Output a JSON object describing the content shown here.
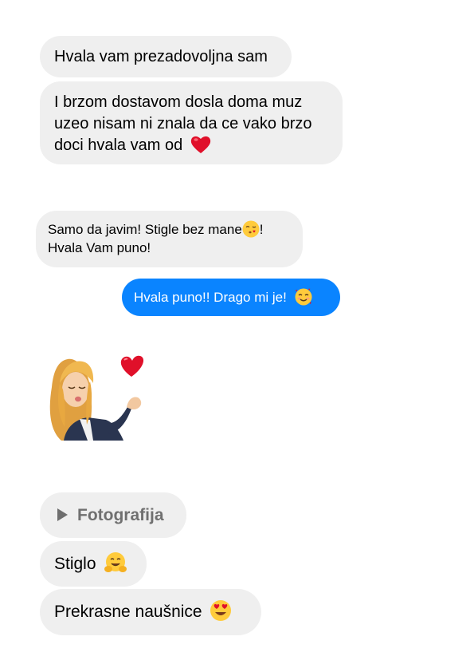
{
  "messages": {
    "m1": "Hvala vam prezadovoljna sam",
    "m2": "I brzom dostavom dosla doma muz uzeo nisam ni znala da ce vako brzo doci hvala vam od",
    "m3_line1": "Samo da javim! Stigle bez mane",
    "m3_tail": "!",
    "m3_line2": "Hvala Vam puno!",
    "m4": "Hvala puno!! Drago mi je!",
    "m5": "Fotografija",
    "m6": "Stiglo",
    "m7": "Prekrasne naušnice"
  },
  "icons": {
    "m2_emoji": "red-heart-emoji",
    "m3_emoji": "kissing-face-emoji",
    "m4_emoji": "smiling-face-with-hearts-emoji",
    "m5_icon": "play-icon",
    "m6_emoji": "hugging-face-emoji",
    "m7_emoji": "heart-eyes-emoji",
    "sticker": "avatar-blowing-kiss-sticker"
  },
  "colors": {
    "incoming_bubble": "#efefef",
    "outgoing_bubble": "#0a84ff",
    "attachment_label": "#707070"
  }
}
